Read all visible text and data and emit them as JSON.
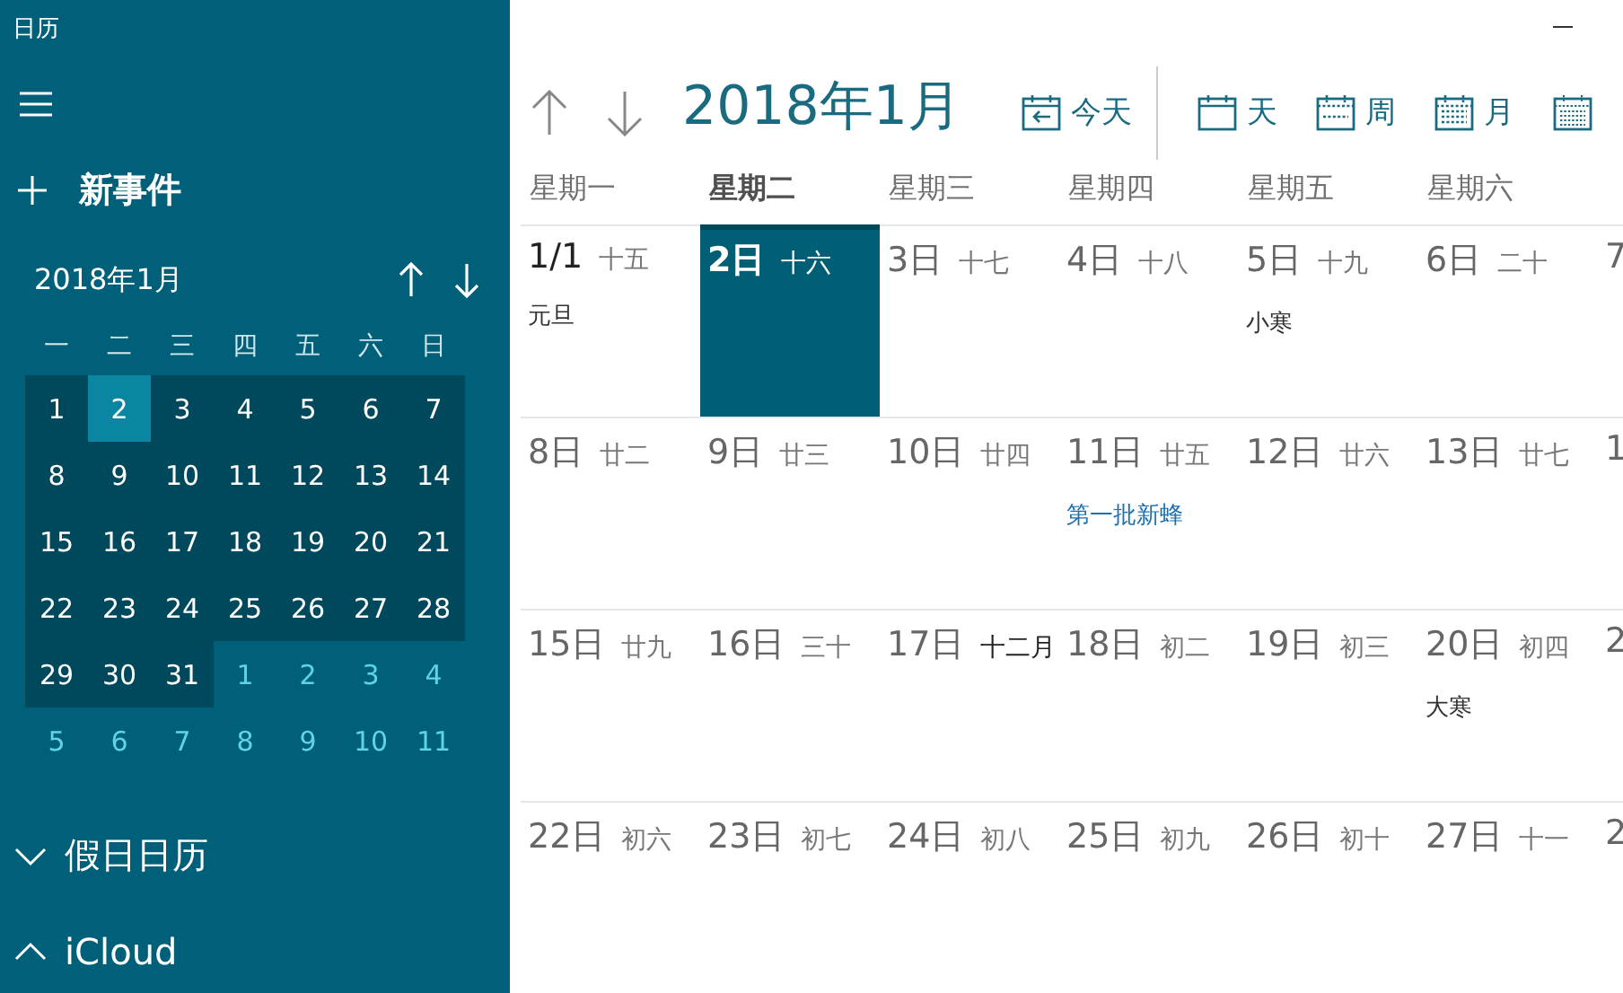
{
  "window": {
    "title": "日历"
  },
  "sidebar": {
    "new_event": "新事件",
    "mini_calendar": {
      "title": "2018年1月",
      "weekdays": [
        "一",
        "二",
        "三",
        "四",
        "五",
        "六",
        "日"
      ],
      "weeks": [
        [
          {
            "day": "1",
            "in_month": true,
            "selected": false
          },
          {
            "day": "2",
            "in_month": true,
            "selected": true
          },
          {
            "day": "3",
            "in_month": true,
            "selected": false
          },
          {
            "day": "4",
            "in_month": true,
            "selected": false
          },
          {
            "day": "5",
            "in_month": true,
            "selected": false
          },
          {
            "day": "6",
            "in_month": true,
            "selected": false
          },
          {
            "day": "7",
            "in_month": true,
            "selected": false
          }
        ],
        [
          {
            "day": "8",
            "in_month": true,
            "selected": false
          },
          {
            "day": "9",
            "in_month": true,
            "selected": false
          },
          {
            "day": "10",
            "in_month": true,
            "selected": false
          },
          {
            "day": "11",
            "in_month": true,
            "selected": false
          },
          {
            "day": "12",
            "in_month": true,
            "selected": false
          },
          {
            "day": "13",
            "in_month": true,
            "selected": false
          },
          {
            "day": "14",
            "in_month": true,
            "selected": false
          }
        ],
        [
          {
            "day": "15",
            "in_month": true,
            "selected": false
          },
          {
            "day": "16",
            "in_month": true,
            "selected": false
          },
          {
            "day": "17",
            "in_month": true,
            "selected": false
          },
          {
            "day": "18",
            "in_month": true,
            "selected": false
          },
          {
            "day": "19",
            "in_month": true,
            "selected": false
          },
          {
            "day": "20",
            "in_month": true,
            "selected": false
          },
          {
            "day": "21",
            "in_month": true,
            "selected": false
          }
        ],
        [
          {
            "day": "22",
            "in_month": true,
            "selected": false
          },
          {
            "day": "23",
            "in_month": true,
            "selected": false
          },
          {
            "day": "24",
            "in_month": true,
            "selected": false
          },
          {
            "day": "25",
            "in_month": true,
            "selected": false
          },
          {
            "day": "26",
            "in_month": true,
            "selected": false
          },
          {
            "day": "27",
            "in_month": true,
            "selected": false
          },
          {
            "day": "28",
            "in_month": true,
            "selected": false
          }
        ],
        [
          {
            "day": "29",
            "in_month": true,
            "selected": false
          },
          {
            "day": "30",
            "in_month": true,
            "selected": false
          },
          {
            "day": "31",
            "in_month": true,
            "selected": false
          },
          {
            "day": "1",
            "in_month": false,
            "selected": false
          },
          {
            "day": "2",
            "in_month": false,
            "selected": false
          },
          {
            "day": "3",
            "in_month": false,
            "selected": false
          },
          {
            "day": "4",
            "in_month": false,
            "selected": false
          }
        ],
        [
          {
            "day": "5",
            "in_month": false,
            "selected": false
          },
          {
            "day": "6",
            "in_month": false,
            "selected": false
          },
          {
            "day": "7",
            "in_month": false,
            "selected": false
          },
          {
            "day": "8",
            "in_month": false,
            "selected": false
          },
          {
            "day": "9",
            "in_month": false,
            "selected": false
          },
          {
            "day": "10",
            "in_month": false,
            "selected": false
          },
          {
            "day": "11",
            "in_month": false,
            "selected": false
          }
        ]
      ]
    },
    "calendars": [
      {
        "name": "假日日历",
        "expanded": false
      },
      {
        "name": "iCloud",
        "expanded": true
      }
    ]
  },
  "main": {
    "title": "2018年1月",
    "views": [
      {
        "label": "今天",
        "kind": "today"
      },
      {
        "label": "天",
        "kind": "day"
      },
      {
        "label": "周",
        "kind": "week"
      },
      {
        "label": "月",
        "kind": "month"
      },
      {
        "kind": "year"
      }
    ],
    "weekdays": [
      {
        "label": "星期一",
        "selected": false
      },
      {
        "label": "星期二",
        "selected": true
      },
      {
        "label": "星期三",
        "selected": false
      },
      {
        "label": "星期四",
        "selected": false
      },
      {
        "label": "星期五",
        "selected": false
      },
      {
        "label": "星期六",
        "selected": false
      }
    ],
    "weeks": [
      [
        {
          "date": "1/1",
          "lunar": "十五",
          "selected": false,
          "note": {
            "text": "元旦",
            "kind": "holiday"
          }
        },
        {
          "date": "2日",
          "lunar": "十六",
          "selected": true
        },
        {
          "date": "3日",
          "lunar": "十七",
          "selected": false
        },
        {
          "date": "4日",
          "lunar": "十八",
          "selected": false
        },
        {
          "date": "5日",
          "lunar": "十九",
          "selected": false,
          "note": {
            "text": "小寒",
            "kind": "holiday"
          }
        },
        {
          "date": "6日",
          "lunar": "二十",
          "selected": false
        },
        {
          "date": "7",
          "selected": false
        }
      ],
      [
        {
          "date": "8日",
          "lunar": "廿二",
          "selected": false
        },
        {
          "date": "9日",
          "lunar": "廿三",
          "selected": false
        },
        {
          "date": "10日",
          "lunar": "廿四",
          "selected": false
        },
        {
          "date": "11日",
          "lunar": "廿五",
          "selected": false,
          "note": {
            "text": "第一批新蜂",
            "kind": "event"
          }
        },
        {
          "date": "12日",
          "lunar": "廿六",
          "selected": false
        },
        {
          "date": "13日",
          "lunar": "廿七",
          "selected": false
        },
        {
          "date": "1",
          "selected": false
        }
      ],
      [
        {
          "date": "15日",
          "lunar": "廿九",
          "selected": false
        },
        {
          "date": "16日",
          "lunar": "三十",
          "selected": false
        },
        {
          "date": "17日",
          "lunar": "十二月",
          "month_start": true,
          "selected": false
        },
        {
          "date": "18日",
          "lunar": "初二",
          "selected": false
        },
        {
          "date": "19日",
          "lunar": "初三",
          "selected": false
        },
        {
          "date": "20日",
          "lunar": "初四",
          "selected": false,
          "note": {
            "text": "大寒",
            "kind": "holiday"
          }
        },
        {
          "date": "2",
          "selected": false
        }
      ],
      [
        {
          "date": "22日",
          "lunar": "初六",
          "selected": false
        },
        {
          "date": "23日",
          "lunar": "初七",
          "selected": false
        },
        {
          "date": "24日",
          "lunar": "初八",
          "selected": false
        },
        {
          "date": "25日",
          "lunar": "初九",
          "selected": false
        },
        {
          "date": "26日",
          "lunar": "初十",
          "selected": false
        },
        {
          "date": "27日",
          "lunar": "十一",
          "selected": false
        },
        {
          "date": "2",
          "selected": false
        }
      ]
    ]
  }
}
